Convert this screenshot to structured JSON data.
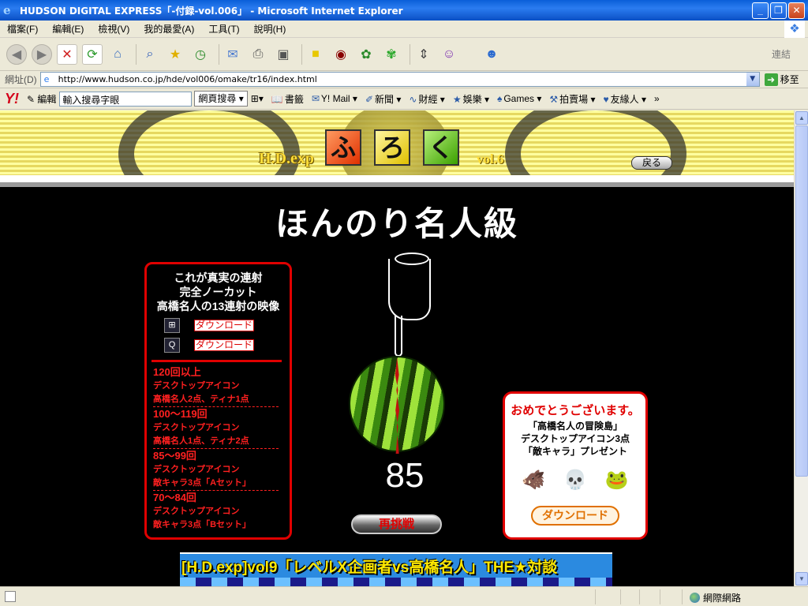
{
  "window": {
    "title": "HUDSON DIGITAL EXPRESS「-付録-vol.006」 - Microsoft Internet Explorer",
    "minimize": "_",
    "maximize": "❐",
    "close": "✕"
  },
  "menu": {
    "items": [
      "檔案(F)",
      "編輯(E)",
      "檢視(V)",
      "我的最愛(A)",
      "工具(T)",
      "說明(H)"
    ]
  },
  "toolbar": {
    "links_label": "連結",
    "icons": [
      "back-icon",
      "forward-icon",
      "stop-icon",
      "refresh-icon",
      "home-icon",
      "search-icon",
      "favorites-icon",
      "history-icon",
      "mail-icon",
      "print-icon",
      "edit-icon",
      "notes-icon",
      "game-icon",
      "pro-icon",
      "icq-icon",
      "switch-icon",
      "yahoo-messenger-icon",
      "messenger-icon"
    ]
  },
  "address": {
    "label": "網址(D)",
    "url": "http://www.hudson.co.jp/hde/vol006/omake/tr16/index.html",
    "go_label": "移至"
  },
  "yahoo": {
    "logo": "Y!",
    "edit_label": "編輯",
    "search_value": "輸入搜尋字眼",
    "search_button": "網頁搜尋",
    "items": [
      "書籤",
      "Y! Mail",
      "新聞",
      "財經",
      "娛樂",
      "Games",
      "拍賣場",
      "友緣人"
    ],
    "more": "»"
  },
  "page": {
    "banner": {
      "hdexp": "H.D.exp",
      "cubes": [
        "ふ",
        "ろ",
        "く"
      ],
      "vol": "vol.6",
      "back_button": "戻る"
    },
    "grade_title": "ほんのり名人級",
    "left_panel": {
      "heading_lines": [
        "これが真実の連射",
        "完全ノーカット",
        "高橋名人の13連射の映像"
      ],
      "download_label": "ダウンロード",
      "tiers": [
        {
          "range": "120回以上",
          "desc1": "デスクトップアイコン",
          "desc2": "高橋名人2点、ティナ1点"
        },
        {
          "range": "100〜119回",
          "desc1": "デスクトップアイコン",
          "desc2": "高橋名人1点、ティナ2点"
        },
        {
          "range": "85〜99回",
          "desc1": "デスクトップアイコン",
          "desc2": "敵キャラ3点「Aセット」"
        },
        {
          "range": "70〜84回",
          "desc1": "デスクトップアイコン",
          "desc2": "敵キャラ3点「Bセット」"
        }
      ]
    },
    "score": "85",
    "retry_button": "再挑戦",
    "right_panel": {
      "congrats": "おめでとうございます。",
      "prize_lines": [
        "「高橋名人の冒険島」",
        "デスクトップアイコン3点",
        "「敵キャラ」プレゼント"
      ],
      "download_label": "ダウンロード"
    },
    "bottom_banner": "[H.D.exp]vol9「レベルX企画者vs高橋名人」THE★対談"
  },
  "status": {
    "zone": "網際網路"
  },
  "colors": {
    "accent_red": "#e00000",
    "xp_blue": "#0a5fd8"
  }
}
